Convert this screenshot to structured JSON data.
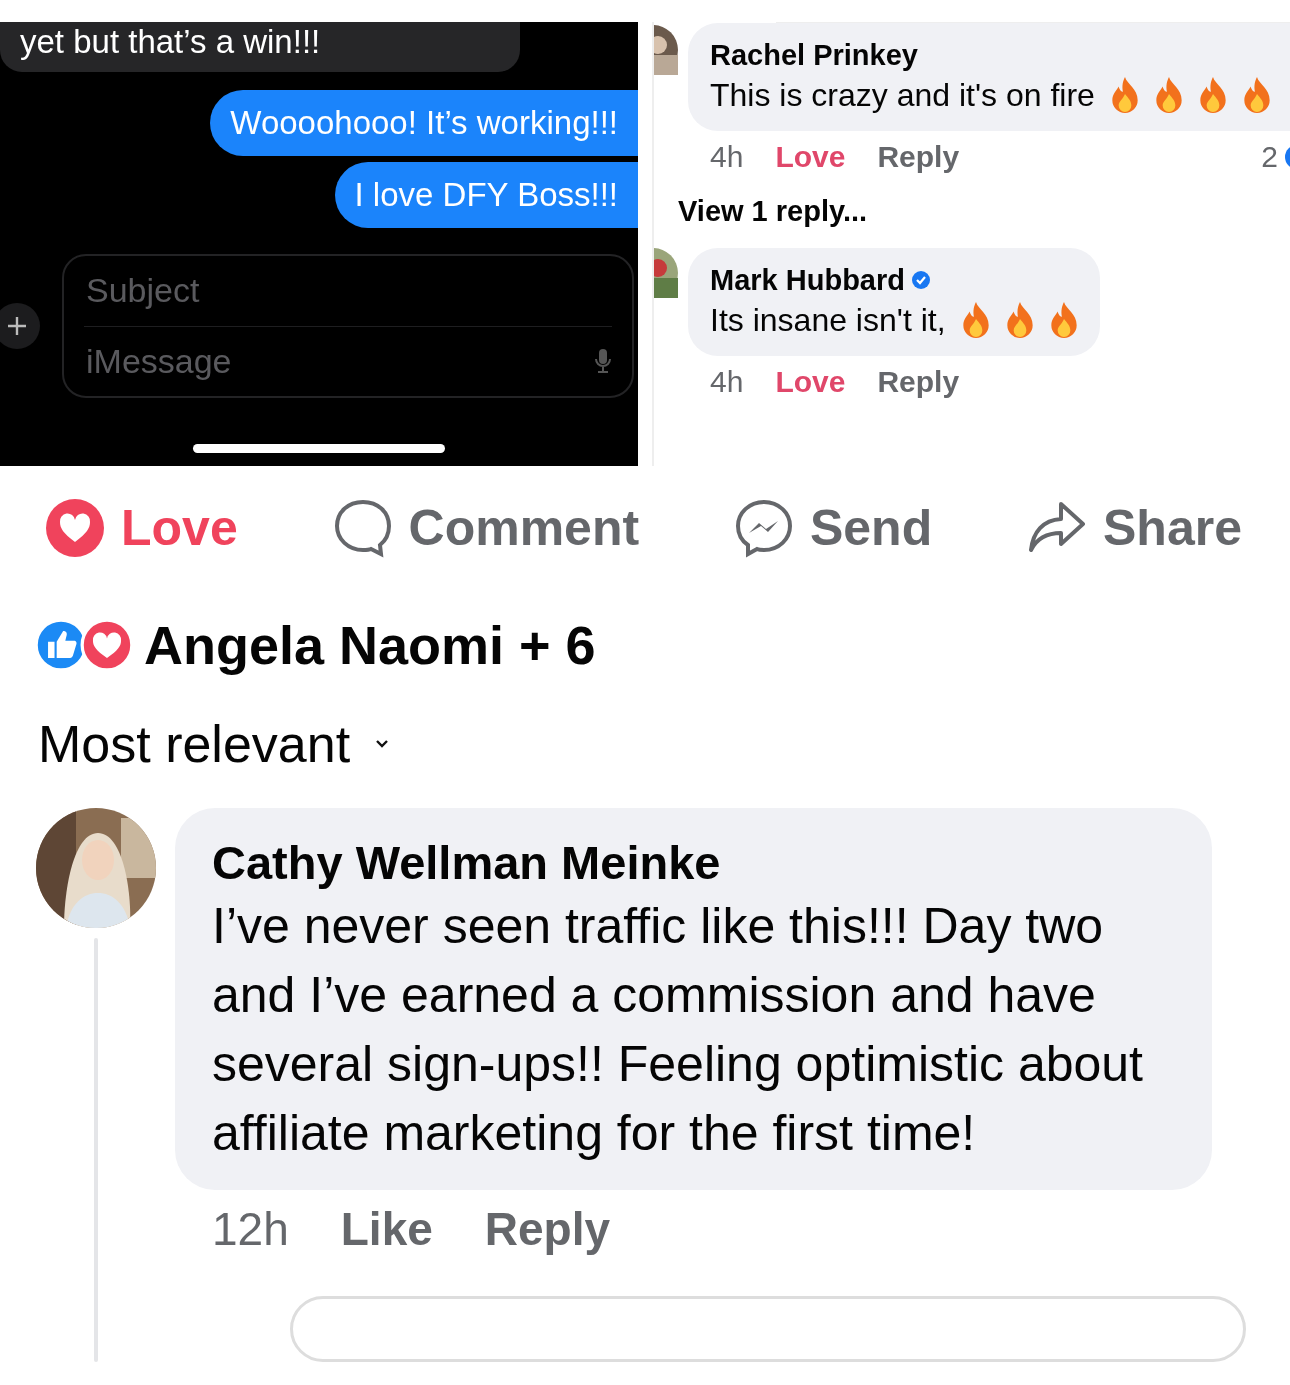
{
  "messages": [
    {
      "text": "yet but that’s a win!!!",
      "sent": false
    },
    {
      "text": "Woooohooo! It’s working!!!",
      "sent": true
    },
    {
      "text": "I love DFY Boss!!!",
      "sent": true
    }
  ],
  "composer": {
    "subject_placeholder": "Subject",
    "message_placeholder": "iMessage"
  },
  "thread_comments": [
    {
      "name": "Rachel Prinkey",
      "verified": false,
      "text": "This is crazy and it's on fire",
      "emojis": [
        {
          "kind": "fire"
        },
        {
          "kind": "fire"
        },
        {
          "kind": "fire"
        },
        {
          "kind": "fire"
        }
      ],
      "time": "4h",
      "reaction_label": "Love",
      "reacted": true,
      "reply_label": "Reply",
      "reaction_count": "2",
      "view_replies": "View 1 reply..."
    },
    {
      "name": "Mark Hubbard",
      "verified": true,
      "text": "Its insane isn't it,",
      "emojis": [
        {
          "kind": "fire"
        },
        {
          "kind": "fire"
        },
        {
          "kind": "fire"
        }
      ],
      "time": "4h",
      "reaction_label": "Love",
      "reacted": true,
      "reply_label": "Reply"
    }
  ],
  "post_actions": [
    {
      "kind": "love",
      "label": "Love",
      "active": true
    },
    {
      "kind": "comment",
      "label": "Comment",
      "active": false
    },
    {
      "kind": "send",
      "label": "Send",
      "active": false
    },
    {
      "kind": "share",
      "label": "Share",
      "active": false
    }
  ],
  "reactions": {
    "icons": [
      {
        "kind": "like"
      },
      {
        "kind": "love"
      }
    ],
    "names": "Angela Naomi + 6"
  },
  "sort": {
    "label": "Most relevant"
  },
  "comment": {
    "name": "Cathy Wellman Meinke",
    "text": "I’ve never seen traffic like this!!! Day two and I’ve earned a commission and have several sign-ups!! Feeling optimistic about affiliate marketing for the first time!",
    "time": "12h",
    "reaction_label": "Like",
    "reacted": false,
    "reply_label": "Reply"
  }
}
